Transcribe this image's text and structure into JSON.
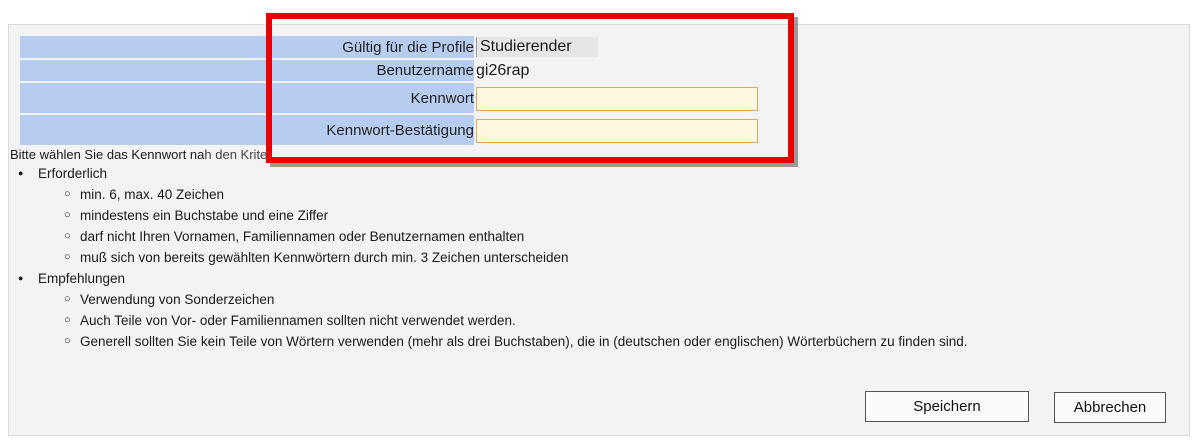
{
  "form": {
    "profile_label": "Gültig für die Profile",
    "profile_value": "Studierender",
    "username_label": "Benutzername",
    "username_value": "gi26rap",
    "password_label": "Kennwort",
    "password_value": "",
    "confirm_label": "Kennwort-Bestätigung",
    "confirm_value": ""
  },
  "instructions": {
    "intro_visible": "Bitte wählen Sie das Kennwort na",
    "intro_partial": "h den Kriter",
    "required": {
      "title": "Erforderlich",
      "items": [
        "min. 6, max. 40 Zeichen",
        "mindestens ein Buchstabe und eine Ziffer",
        "darf nicht Ihren Vornamen, Familiennamen oder Benutzernamen enthalten",
        "muß sich von bereits gewählten Kennwörtern durch min. 3 Zeichen unterscheiden"
      ]
    },
    "recommended": {
      "title": "Empfehlungen",
      "items": [
        "Verwendung von Sonderzeichen",
        "Auch Teile von Vor- oder Familiennamen sollten nicht verwendet werden.",
        "Generell sollten Sie kein Teile von Wörtern verwenden (mehr als drei Buchstaben), die in (deutschen oder englischen) Wörterbüchern zu finden sind."
      ]
    }
  },
  "buttons": {
    "save": "Speichern",
    "cancel": "Abbrechen"
  },
  "colors": {
    "label_bg": "#b7cdf0",
    "input_bg": "#fff7e0",
    "highlight": "#e60000"
  }
}
